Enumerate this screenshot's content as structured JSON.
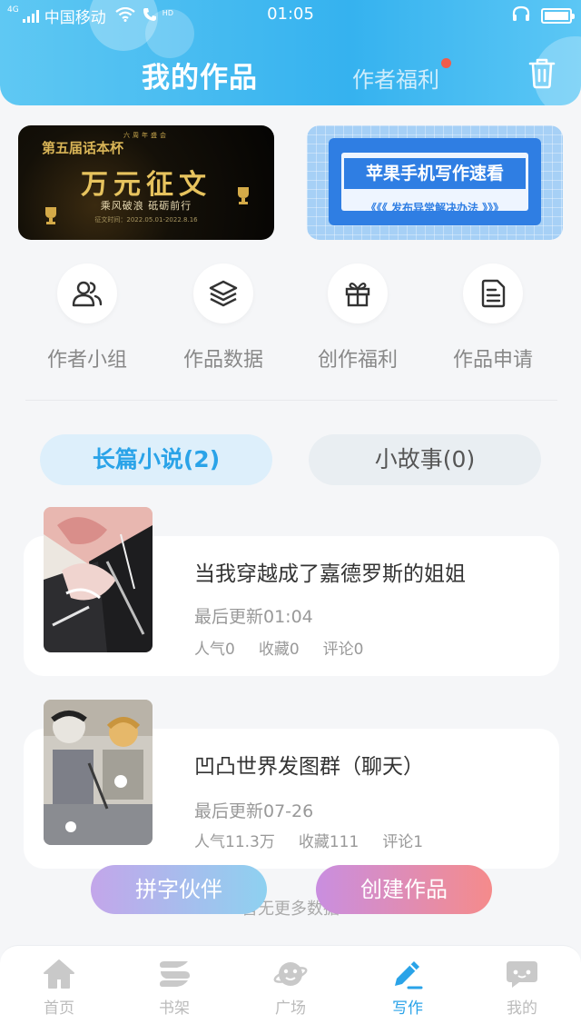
{
  "status_bar": {
    "network": "4G",
    "carrier": "中国移动",
    "hd": "HD",
    "time": "01:05"
  },
  "header": {
    "title": "我的作品",
    "tab_welfare": "作者福利"
  },
  "banners": {
    "left": {
      "top_text": "六周年盛会",
      "heading": "第五届话本杯",
      "title": "万元征文",
      "subtitle": "乘风破浪 砥砺前行",
      "date": "征文时间：2022.05.01-2022.8.16"
    },
    "right": {
      "title": "苹果手机写作速看",
      "subtitle": "《《《 发布异常解决办法 》》》"
    }
  },
  "quick_entries": [
    {
      "label": "作者小组",
      "icon": "people-icon"
    },
    {
      "label": "作品数据",
      "icon": "layers-icon"
    },
    {
      "label": "创作福利",
      "icon": "gift-icon"
    },
    {
      "label": "作品申请",
      "icon": "document-icon"
    }
  ],
  "segments": {
    "novel": "长篇小说(2)",
    "story": "小故事(0)"
  },
  "works": [
    {
      "title": "当我穿越成了嘉德罗斯的姐姐",
      "updated": "最后更新01:04",
      "popularity": "人气0",
      "favorites": "收藏0",
      "comments": "评论0"
    },
    {
      "title": "凹凸世界发图群（聊天）",
      "updated": "最后更新07-26",
      "popularity": "人气11.3万",
      "favorites": "收藏111",
      "comments": "评论1"
    }
  ],
  "no_more": "暂无更多数据",
  "fabs": {
    "partner": "拼字伙伴",
    "create": "创建作品"
  },
  "tabbar": [
    {
      "label": "首页",
      "icon": "home-icon"
    },
    {
      "label": "书架",
      "icon": "bookshelf-icon"
    },
    {
      "label": "广场",
      "icon": "planet-icon"
    },
    {
      "label": "写作",
      "icon": "pen-icon",
      "active": true
    },
    {
      "label": "我的",
      "icon": "chat-icon"
    }
  ],
  "colors": {
    "header_blue": "#35b2ef",
    "accent_blue": "#2aa3e8",
    "badge_red": "#f25b4a"
  }
}
